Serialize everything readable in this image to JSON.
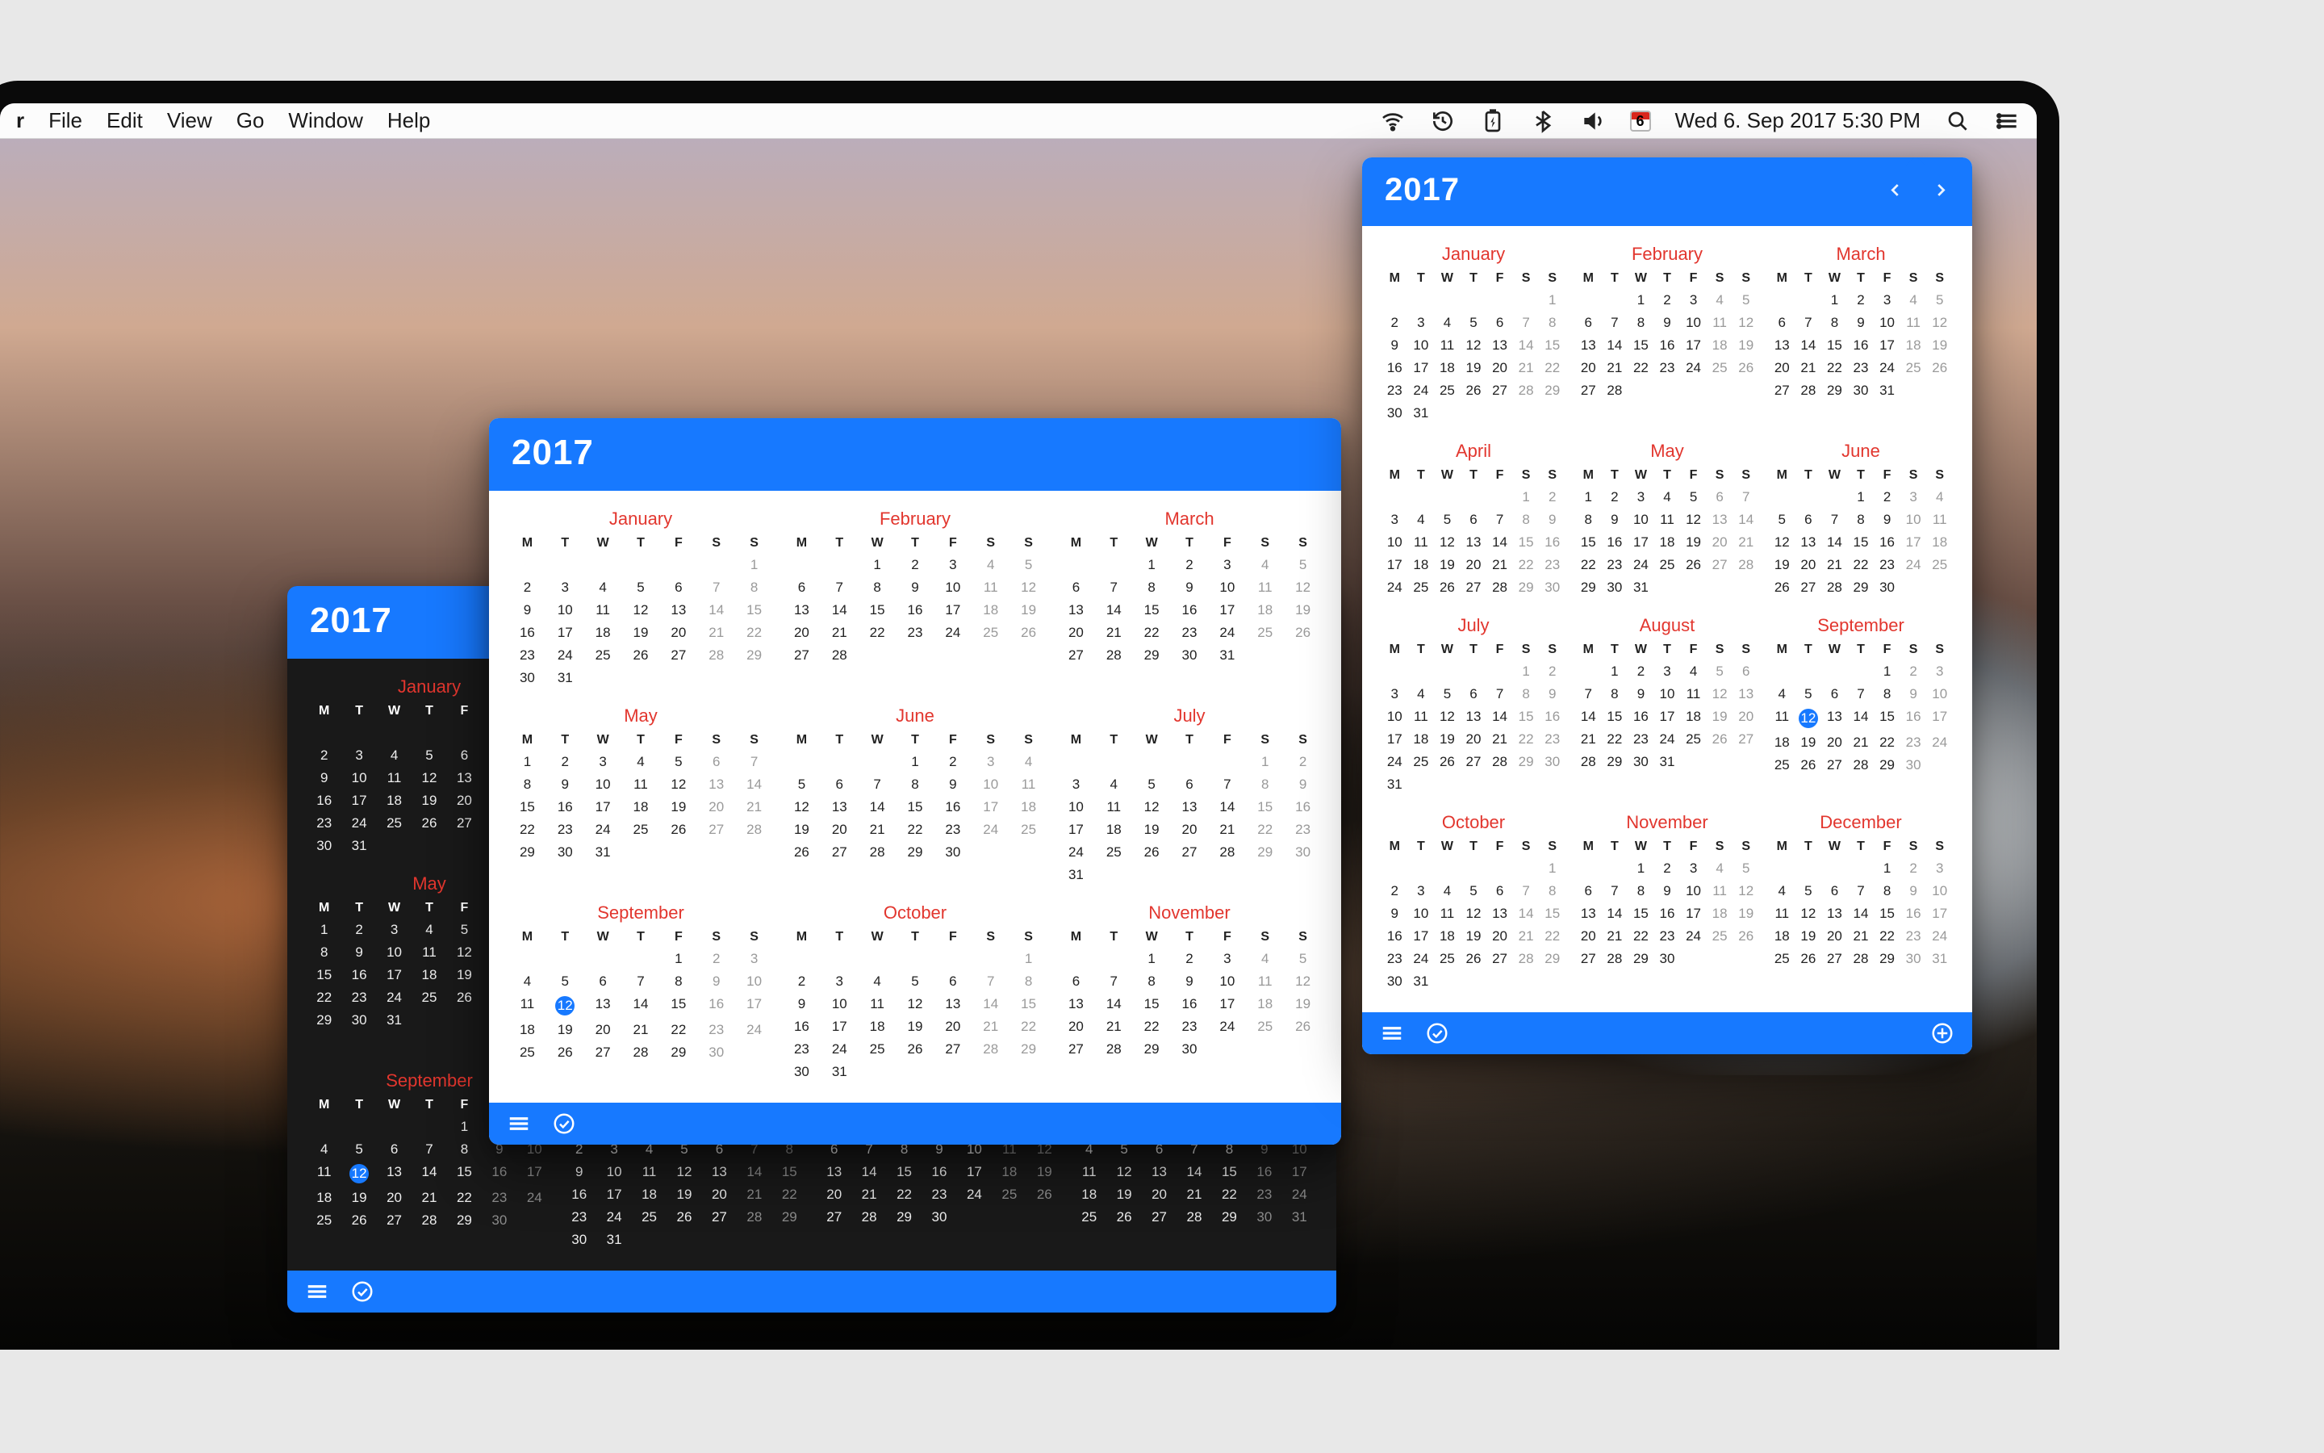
{
  "menu": {
    "app_fragment": "r",
    "items": [
      "File",
      "Edit",
      "View",
      "Go",
      "Window",
      "Help"
    ],
    "badge_day": "6",
    "datetime": "Wed 6. Sep 2017 5:30 PM"
  },
  "year": "2017",
  "today": {
    "month": 9,
    "day": 12
  },
  "dow": [
    "M",
    "T",
    "W",
    "T",
    "F",
    "S",
    "S"
  ],
  "months": [
    {
      "name": "January",
      "start": 6,
      "len": 31
    },
    {
      "name": "February",
      "start": 2,
      "len": 28
    },
    {
      "name": "March",
      "start": 2,
      "len": 31
    },
    {
      "name": "April",
      "start": 5,
      "len": 30
    },
    {
      "name": "May",
      "start": 0,
      "len": 31
    },
    {
      "name": "June",
      "start": 3,
      "len": 30
    },
    {
      "name": "July",
      "start": 5,
      "len": 31
    },
    {
      "name": "August",
      "start": 1,
      "len": 31
    },
    {
      "name": "September",
      "start": 4,
      "len": 30
    },
    {
      "name": "October",
      "start": 6,
      "len": 31
    },
    {
      "name": "November",
      "start": 2,
      "len": 30
    },
    {
      "name": "December",
      "start": 4,
      "len": 31
    }
  ],
  "windows": {
    "w1": {
      "theme": "dark",
      "months": [
        1,
        2,
        3,
        4,
        5,
        6,
        7,
        8,
        9,
        10,
        11,
        12
      ]
    },
    "w2": {
      "theme": "light",
      "months": [
        1,
        2,
        3,
        5,
        6,
        7,
        9,
        10,
        11
      ]
    },
    "w3": {
      "theme": "light",
      "months": [
        1,
        2,
        3,
        4,
        5,
        6,
        7,
        8,
        9,
        10,
        11,
        12
      ],
      "nav": true,
      "plus": true
    }
  }
}
